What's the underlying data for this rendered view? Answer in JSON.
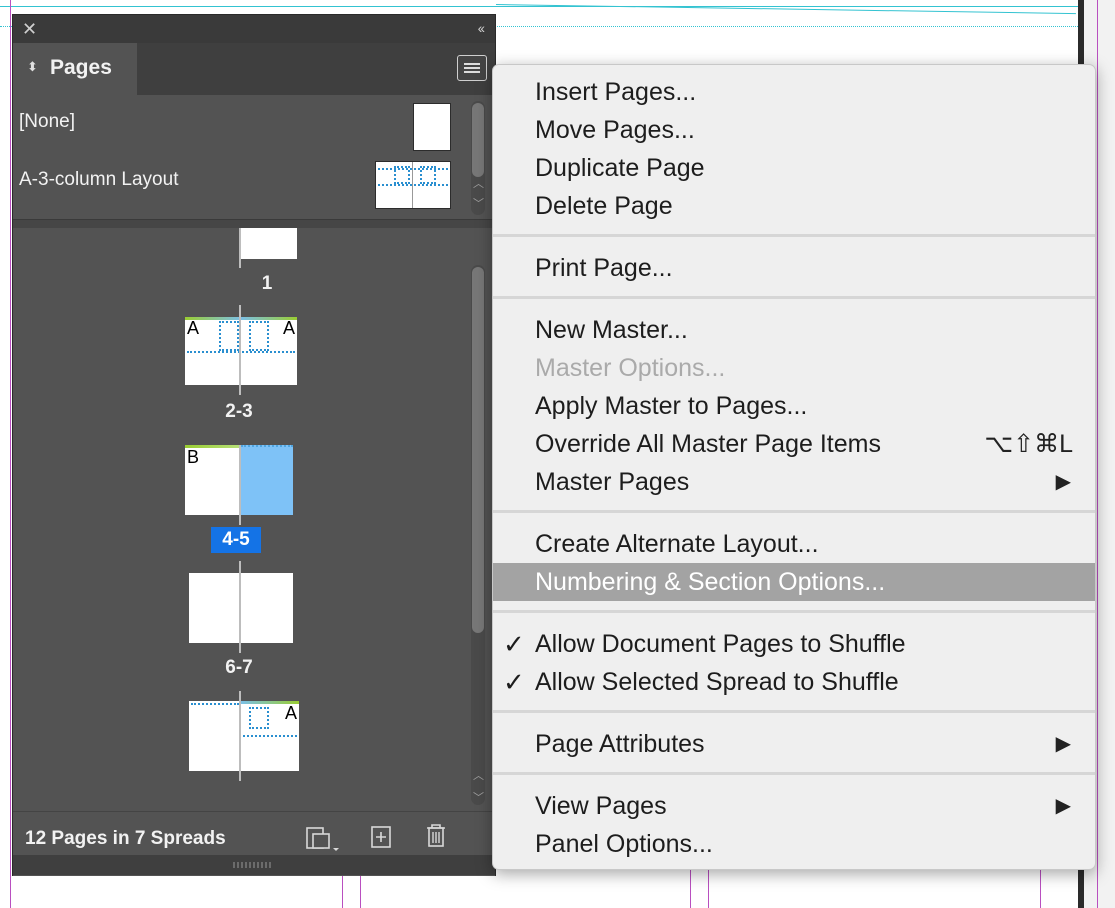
{
  "panel": {
    "tab_label": "Pages",
    "masters": [
      {
        "label": "[None]"
      },
      {
        "label": "A-3-column Layout"
      }
    ],
    "spreads": [
      {
        "label": "1"
      },
      {
        "label": "2-3",
        "master_left": "A",
        "master_right": "A"
      },
      {
        "label": "4-5",
        "master_left": "B",
        "selected": true
      },
      {
        "label": "6-7"
      },
      {
        "label": "",
        "master_right": "A"
      }
    ],
    "footer_text": "12 Pages in 7 Spreads"
  },
  "menu": {
    "groups": [
      [
        {
          "label": "Insert Pages..."
        },
        {
          "label": "Move Pages..."
        },
        {
          "label": "Duplicate Page"
        },
        {
          "label": "Delete Page"
        }
      ],
      [
        {
          "label": "Print Page..."
        }
      ],
      [
        {
          "label": "New Master..."
        },
        {
          "label": "Master Options...",
          "disabled": true
        },
        {
          "label": "Apply Master to Pages..."
        },
        {
          "label": "Override All Master Page Items",
          "shortcut": "⌥⇧⌘L"
        },
        {
          "label": "Master Pages",
          "submenu": true
        }
      ],
      [
        {
          "label": "Create Alternate Layout..."
        },
        {
          "label": "Numbering & Section Options...",
          "highlighted": true
        }
      ],
      [
        {
          "label": "Allow Document Pages to Shuffle",
          "checked": true
        },
        {
          "label": "Allow Selected Spread to Shuffle",
          "checked": true
        }
      ],
      [
        {
          "label": "Page Attributes",
          "submenu": true
        }
      ],
      [
        {
          "label": "View Pages",
          "submenu": true
        },
        {
          "label": "Panel Options..."
        }
      ]
    ],
    "check_glyph": "✓",
    "submenu_glyph": "▶"
  },
  "colors": {
    "selection": "#1473e6",
    "panel_bg": "#535353",
    "menu_highlight": "#a3a3a3",
    "selected_page": "#7ec2f7"
  }
}
